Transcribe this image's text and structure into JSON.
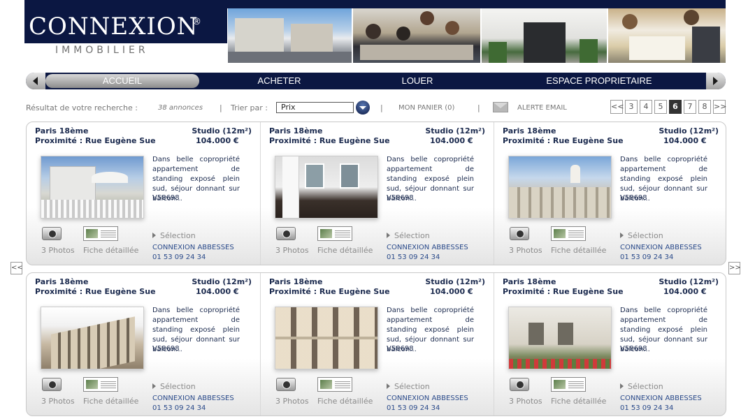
{
  "brand": {
    "name": "CONNEXION",
    "reg": "®",
    "tagline": "IMMOBILIER"
  },
  "nav": {
    "items": [
      {
        "label": "ACCUEIL",
        "active": true
      },
      {
        "label": "ACHETER"
      },
      {
        "label": "LOUER"
      },
      {
        "label": "ESPACE PROPRIETAIRE"
      }
    ]
  },
  "toolbar": {
    "result_label": "Résultat de votre recherche :",
    "result_count": "38 annonces",
    "sep": "|",
    "sort_label": "Trier par :",
    "sort_value": "Prix",
    "basket": "MON PANIER (0)",
    "alert": "ALERTE EMAIL"
  },
  "pager": {
    "prev": "<<",
    "next": ">>",
    "pages": [
      "3",
      "4",
      "5",
      "6",
      "7",
      "8"
    ],
    "current": "6"
  },
  "listings": [
    {
      "city": "Paris 18ème",
      "proximity": "Proximité : Rue Eugène Sue",
      "type": "Studio (12m²)",
      "price": "104.000 €",
      "desc": "Dans belle copropriété appartement de standing exposé plein sud, séjour donnant sur balcon...",
      "ref": "V58698",
      "photos": "3 Photos",
      "fiche": "Fiche détaillée",
      "select": "Sélection",
      "agency": "CONNEXION ABBESSES",
      "phone": "01 53 09 24 34"
    },
    {
      "city": "Paris 18ème",
      "proximity": "Proximité : Rue Eugène Sue",
      "type": "Studio (12m²)",
      "price": "104.000 €",
      "desc": "Dans belle copropriété appartement de standing exposé plein sud, séjour donnant sur balcon...",
      "ref": "V58698",
      "photos": "3 Photos",
      "fiche": "Fiche détaillée",
      "select": "Sélection",
      "agency": "CONNEXION ABBESSES",
      "phone": "01 53 09 24 34"
    },
    {
      "city": "Paris 18ème",
      "proximity": "Proximité : Rue Eugène Sue",
      "type": "Studio (12m²)",
      "price": "104.000 €",
      "desc": "Dans belle copropriété appartement de standing exposé plein sud, séjour donnant sur balcon...",
      "ref": "V58698",
      "photos": "3 Photos",
      "fiche": "Fiche détaillée",
      "select": "Sélection",
      "agency": "CONNEXION ABBESSES",
      "phone": "01 53 09 24 34"
    },
    {
      "city": "Paris 18ème",
      "proximity": "Proximité : Rue Eugène Sue",
      "type": "Studio (12m²)",
      "price": "104.000 €",
      "desc": "Dans belle copropriété appartement de standing exposé plein sud, séjour donnant sur balcon...",
      "ref": "V58698",
      "photos": "3 Photos",
      "fiche": "Fiche détaillée",
      "select": "Sélection",
      "agency": "CONNEXION ABBESSES",
      "phone": "01 53 09 24 34"
    },
    {
      "city": "Paris 18ème",
      "proximity": "Proximité : Rue Eugène Sue",
      "type": "Studio (12m²)",
      "price": "104.000 €",
      "desc": "Dans belle copropriété appartement de standing exposé plein sud, séjour donnant sur balcon...",
      "ref": "V58698",
      "photos": "3 Photos",
      "fiche": "Fiche détaillée",
      "select": "Sélection",
      "agency": "CONNEXION ABBESSES",
      "phone": "01 53 09 24 34"
    },
    {
      "city": "Paris 18ème",
      "proximity": "Proximité : Rue Eugène Sue",
      "type": "Studio (12m²)",
      "price": "104.000 €",
      "desc": "Dans belle copropriété appartement de standing exposé plein sud, séjour donnant sur balcon...",
      "ref": "V58698",
      "photos": "3 Photos",
      "fiche": "Fiche détaillée",
      "select": "Sélection",
      "agency": "CONNEXION ABBESSES",
      "phone": "01 53 09 24 34"
    }
  ],
  "side_nav": {
    "prev": "<<",
    "next": ">>"
  },
  "colors": {
    "brand_navy": "#0b1742",
    "text": "#1b2a4e",
    "link": "#2a4a8a"
  }
}
